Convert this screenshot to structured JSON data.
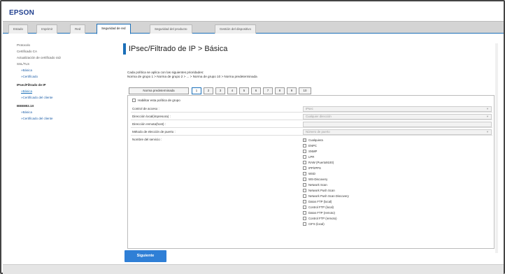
{
  "brand": "EPSON",
  "tabs": [
    {
      "label": "Estado",
      "active": false
    },
    {
      "label": "Imprimir",
      "active": false
    },
    {
      "label": "Red",
      "active": false
    },
    {
      "label": "Seguridad de red",
      "active": true
    },
    {
      "label": "Seguridad del producto",
      "active": false
    },
    {
      "label": "Gestión del dispositivo",
      "active": false
    }
  ],
  "sidebar": {
    "items": [
      {
        "label": "Protocolo"
      },
      {
        "label": "Certificado CA"
      },
      {
        "label": "Actualización de certificado raíz"
      },
      {
        "label": "SSL/TLS"
      },
      {
        "label": "»Básica"
      },
      {
        "label": "»Certificado"
      },
      {
        "label": "IPsec/Filtrado de IP"
      },
      {
        "label": "»Básica"
      },
      {
        "label": "»Certificado del cliente"
      },
      {
        "label": "IEEE802.1X"
      },
      {
        "label": "»Básica"
      },
      {
        "label": "»Certificado del cliente"
      }
    ]
  },
  "page": {
    "title": "IPsec/Filtrado de IP > Básica",
    "info_line1": "Cada política se aplica con las siguientes prioridades:",
    "info_line2": "Norma de grupo 1 > Norma de grupo 2 > ... > Norma de grupo 10 > Norma predeterminada"
  },
  "policy_tabs": [
    "Norma predeterminada",
    "1",
    "2",
    "3",
    "4",
    "5",
    "6",
    "7",
    "8",
    "9",
    "10"
  ],
  "form": {
    "enable_label": "Habilitar esta política de grupo",
    "rows": [
      {
        "label": "Control de acceso :",
        "value": "IPsec"
      },
      {
        "label": "Dirección local(impresora) :",
        "value": "Cualquier dirección"
      },
      {
        "label": "Dirección remota(host) :",
        "value": ""
      },
      {
        "label": "Método de elección de puerto :",
        "value": "Número de puerto"
      }
    ],
    "service_label": "Nombre del servicio :",
    "services": [
      {
        "label": "Cualquiera",
        "checked": true
      },
      {
        "label": "ENPC",
        "checked": false
      },
      {
        "label": "SNMP",
        "checked": false
      },
      {
        "label": "LPR",
        "checked": false
      },
      {
        "label": "RAW (Puerto9100)",
        "checked": false
      },
      {
        "label": "IPP/IPPS",
        "checked": false
      },
      {
        "label": "WSD",
        "checked": false
      },
      {
        "label": "WS-Discovery",
        "checked": false
      },
      {
        "label": "Network Scan",
        "checked": false
      },
      {
        "label": "Network Push Scan",
        "checked": false
      },
      {
        "label": "Network Push Scan Discovery",
        "checked": false
      },
      {
        "label": "Datos FTP (local)",
        "checked": false
      },
      {
        "label": "Control FTP (local)",
        "checked": false
      },
      {
        "label": "Datos FTP (remoto)",
        "checked": false
      },
      {
        "label": "Control FTP (remoto)",
        "checked": false
      },
      {
        "label": "CIFS (local)",
        "checked": false
      }
    ]
  },
  "next_button": "Siguiente",
  "colors": {
    "accent": "#1b6fb8",
    "brand": "#1f3f8f",
    "button": "#2f7fd6"
  }
}
